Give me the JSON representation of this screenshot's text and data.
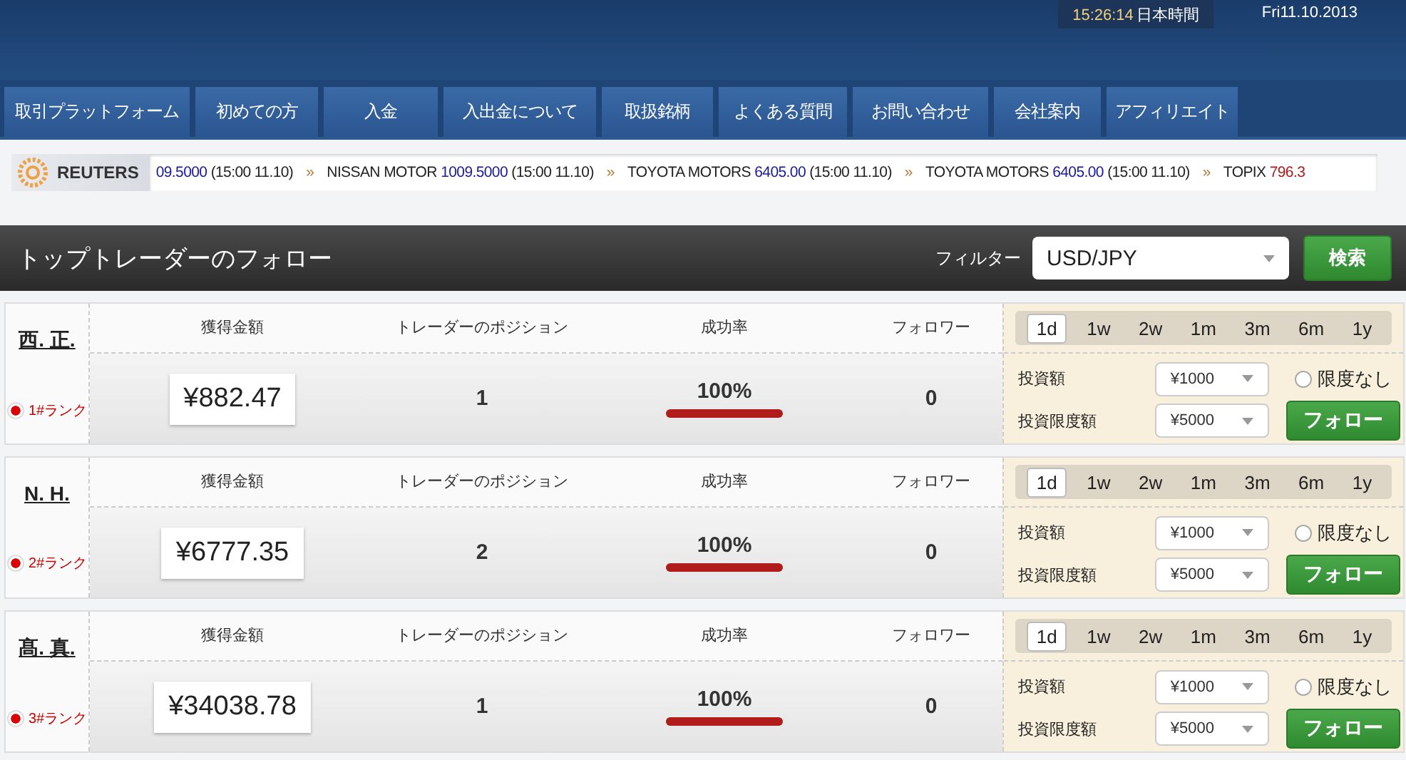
{
  "header": {
    "clock": {
      "time": "15:26:14",
      "zone": "日本時間"
    },
    "date": "Fri11.10.2013"
  },
  "nav": [
    {
      "label": "取引プラットフォーム"
    },
    {
      "label": "初めての方"
    },
    {
      "label": "入金"
    },
    {
      "label": "入出金について"
    },
    {
      "label": "取扱銘柄"
    },
    {
      "label": "よくある質問"
    },
    {
      "label": "お問い合わせ"
    },
    {
      "label": "会社案内"
    },
    {
      "label": "アフィリエイト"
    }
  ],
  "ticker": {
    "brand": "REUTERS",
    "items": [
      {
        "value": "09.5000",
        "time": "(15:00 11.10)",
        "color": "#1a1a9e"
      },
      {
        "name": "NISSAN MOTOR",
        "value": "1009.5000",
        "time": "(15:00 11.10)",
        "color": "#1a1a9e"
      },
      {
        "name": "TOYOTA MOTORS",
        "value": "6405.00",
        "time": "(15:00 11.10)",
        "color": "#1a1a9e"
      },
      {
        "name": "TOYOTA MOTORS",
        "value": "6405.00",
        "time": "(15:00 11.10)",
        "color": "#1a1a9e"
      },
      {
        "name": "TOPIX",
        "value": "796.3",
        "color": "#b01818"
      }
    ],
    "separator": "»"
  },
  "panel": {
    "title": "トップトレーダーのフォロー",
    "filter_label": "フィルター",
    "filter_value": "USD/JPY",
    "search_button": "検索"
  },
  "traders": [
    {
      "name": "西. 正.",
      "rank": "1#ランク",
      "labels": [
        "獲得金額",
        "トレーダーのポジション",
        "成功率",
        "フォロワー"
      ],
      "profit": "¥882.47",
      "positions": "1",
      "success": "100%",
      "level": 1,
      "followers": "0",
      "periods": [
        {
          "label": "1d",
          "selected": true
        },
        {
          "label": "1w",
          "selected": false
        },
        {
          "label": "2w",
          "selected": false
        },
        {
          "label": "1m",
          "selected": false
        },
        {
          "label": "3m",
          "selected": false
        },
        {
          "label": "6m",
          "selected": false
        },
        {
          "label": "1y",
          "selected": false
        }
      ],
      "amount_label": "投資額",
      "amount": "¥1000",
      "limit_label": "投資限度額",
      "limit": "¥5000",
      "unlimited": {
        "label": "限度なし",
        "checked": false
      },
      "follow_button": "フォロー"
    },
    {
      "name": "N. H.",
      "rank": "2#ランク",
      "labels": [
        "獲得金額",
        "トレーダーのポジション",
        "成功率",
        "フォロワー"
      ],
      "profit": "¥6777.35",
      "positions": "2",
      "success": "100%",
      "level": 1,
      "followers": "0",
      "periods": [
        {
          "label": "1d",
          "selected": true
        },
        {
          "label": "1w",
          "selected": false
        },
        {
          "label": "2w",
          "selected": false
        },
        {
          "label": "1m",
          "selected": false
        },
        {
          "label": "3m",
          "selected": false
        },
        {
          "label": "6m",
          "selected": false
        },
        {
          "label": "1y",
          "selected": false
        }
      ],
      "amount_label": "投資額",
      "amount": "¥1000",
      "limit_label": "投資限度額",
      "limit": "¥5000",
      "unlimited": {
        "label": "限度なし",
        "checked": false
      },
      "follow_button": "フォロー"
    },
    {
      "name": "髙. 真.",
      "rank": "3#ランク",
      "labels": [
        "獲得金額",
        "トレーダーのポジション",
        "成功率",
        "フォロワー"
      ],
      "profit": "¥34038.78",
      "positions": "1",
      "success": "100%",
      "level": 1,
      "followers": "0",
      "periods": [
        {
          "label": "1d",
          "selected": true
        },
        {
          "label": "1w",
          "selected": false
        },
        {
          "label": "2w",
          "selected": false
        },
        {
          "label": "1m",
          "selected": false
        },
        {
          "label": "3m",
          "selected": false
        },
        {
          "label": "6m",
          "selected": false
        },
        {
          "label": "1y",
          "selected": false
        }
      ],
      "amount_label": "投資額",
      "amount": "¥1000",
      "limit_label": "投資限度額",
      "limit": "¥5000",
      "unlimited": {
        "label": "限度なし",
        "checked": false
      },
      "follow_button": "フォロー"
    }
  ]
}
